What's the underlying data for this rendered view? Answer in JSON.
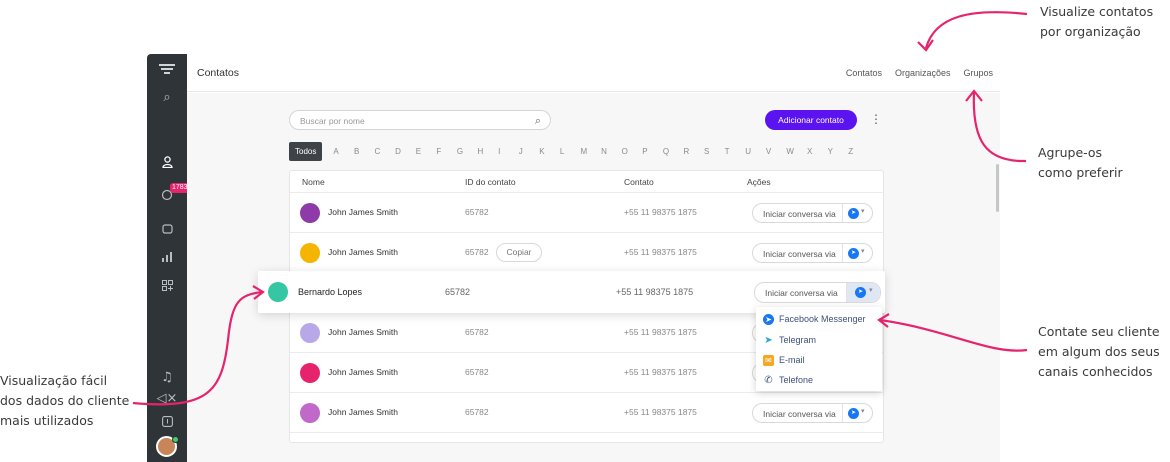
{
  "annotations": {
    "top_right": [
      "Visualize contatos",
      "por organização"
    ],
    "right_1": [
      "Agrupe-os",
      "como preferir"
    ],
    "right_2": [
      "Contate seu cliente",
      "em algum dos seus",
      "canais conhecidos"
    ],
    "left": [
      "Visualização fácil",
      "dos dados do cliente",
      "mais utilizados"
    ]
  },
  "colors": {
    "accent": "#5b14f0",
    "arrow": "#e5246d",
    "sidebar": "#2e3437",
    "badge": "#e5246d"
  },
  "sidebar": {
    "logo_icon": "logo-icon",
    "badge_count": "1783",
    "icons": [
      "search-icon",
      "contacts-icon",
      "chat-icon",
      "bot-icon",
      "reports-icon",
      "apps-icon",
      "bell-icon",
      "mute-icon",
      "info-icon"
    ]
  },
  "header": {
    "title": "Contatos",
    "nav": [
      "Contatos",
      "Organizações",
      "Grupos"
    ]
  },
  "toolbar": {
    "search_placeholder": "Buscar por nome",
    "add_button": "Adicionar contato"
  },
  "alphabet": {
    "all_label": "Todos",
    "letters": [
      "A",
      "B",
      "C",
      "D",
      "E",
      "F",
      "G",
      "H",
      "I",
      "J",
      "K",
      "L",
      "M",
      "N",
      "O",
      "P",
      "Q",
      "R",
      "S",
      "T",
      "U",
      "V",
      "W",
      "X",
      "Y",
      "Z"
    ]
  },
  "table": {
    "headers": {
      "name": "Nome",
      "id": "ID do contato",
      "contact": "Contato",
      "actions": "Ações"
    },
    "action_label": "Iniciar conversa via",
    "copy_label": "Copiar",
    "rows": [
      {
        "name": "John James Smith",
        "id": "65782",
        "phone": "+55 11 98375 1875",
        "avatar_color": "#8e3aa8"
      },
      {
        "name": "John James Smith",
        "id": "65782",
        "phone": "+55 11 98375 1875",
        "avatar_color": "#f5b400"
      },
      {
        "name": "John James Smith",
        "id": "65782",
        "phone": "+55 11 98375 1875",
        "avatar_color": "#b9a8e8"
      },
      {
        "name": "John James Smith",
        "id": "65782",
        "phone": "+55 11 98375 1875",
        "avatar_color": "#e5246d"
      },
      {
        "name": "John James Smith",
        "id": "65782",
        "phone": "+55 11 98375 1875",
        "avatar_color": "#c069c9"
      }
    ],
    "highlighted": {
      "name": "Bernardo Lopes",
      "id": "65782",
      "phone": "+55 11 98375 1875",
      "avatar_color": "#35c6a4"
    }
  },
  "channels": [
    {
      "label": "Facebook Messenger",
      "icon": "messenger-icon",
      "color": "#1877f2"
    },
    {
      "label": "Telegram",
      "icon": "telegram-icon",
      "color": "#2aa3e0"
    },
    {
      "label": "E-mail",
      "icon": "email-icon",
      "color": "#f5a623"
    },
    {
      "label": "Telefone",
      "icon": "phone-icon",
      "color": "#3c4f7a"
    }
  ]
}
